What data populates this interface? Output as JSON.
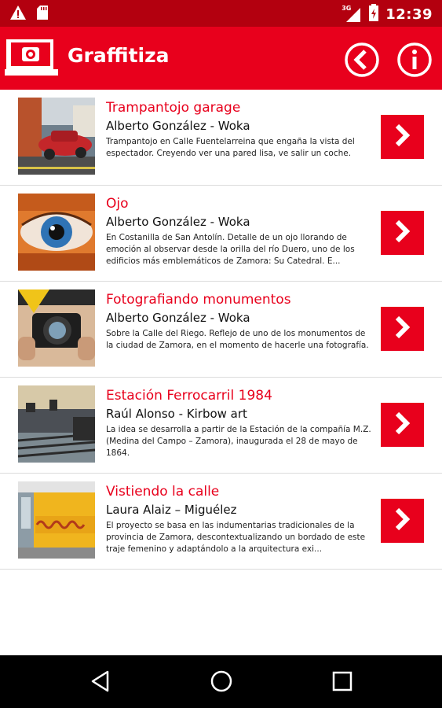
{
  "status_bar": {
    "time": "12:39",
    "network": "3G",
    "icons": [
      "warning-icon",
      "sd-card-icon",
      "signal-icon",
      "battery-icon"
    ]
  },
  "app_bar": {
    "title": "Graffitiza",
    "actions": [
      "back-circle-icon",
      "info-circle-icon"
    ]
  },
  "items": [
    {
      "title": "Trampantojo garage",
      "author": "Alberto González - Woka",
      "description": "Trampantojo en Calle Fuentelarreina que engaña la vista del espectador. Creyendo ver una pared lisa, ve salir un coche."
    },
    {
      "title": "Ojo",
      "author": "Alberto González - Woka",
      "description": "En Costanilla de San Antolín. Detalle de un ojo llorando de emoción al observar desde la orilla del río Duero, uno de los edificios más emblemáticos de Zamora: Su Catedral. E..."
    },
    {
      "title": "Fotografiando monumentos",
      "author": "Alberto González - Woka",
      "description": "Sobre la Calle del Riego. Reflejo de uno de los monumentos de la ciudad de Zamora, en el momento de hacerle una fotografía."
    },
    {
      "title": "Estación Ferrocarril 1984",
      "author": "Raúl Alonso - Kirbow art",
      "description": "La idea se desarrolla a partir de la Estación de la compañía M.Z. (Medina del Campo – Zamora), inaugurada el 28 de mayo de 1864."
    },
    {
      "title": "Vistiendo la calle",
      "author": "Laura Alaiz – Miguélez",
      "description": "El proyecto se basa en las indumentarias tradicionales de la provincia de Zamora, descontextualizando un bordado de este traje femenino y adaptándolo a la arquitectura exi..."
    }
  ],
  "nav_bar": {
    "buttons": [
      "back-triangle-icon",
      "home-circle-icon",
      "recents-square-icon"
    ]
  },
  "colors": {
    "accent": "#e8001c",
    "status_bar": "#b3000f",
    "nav_bar": "#000000"
  }
}
